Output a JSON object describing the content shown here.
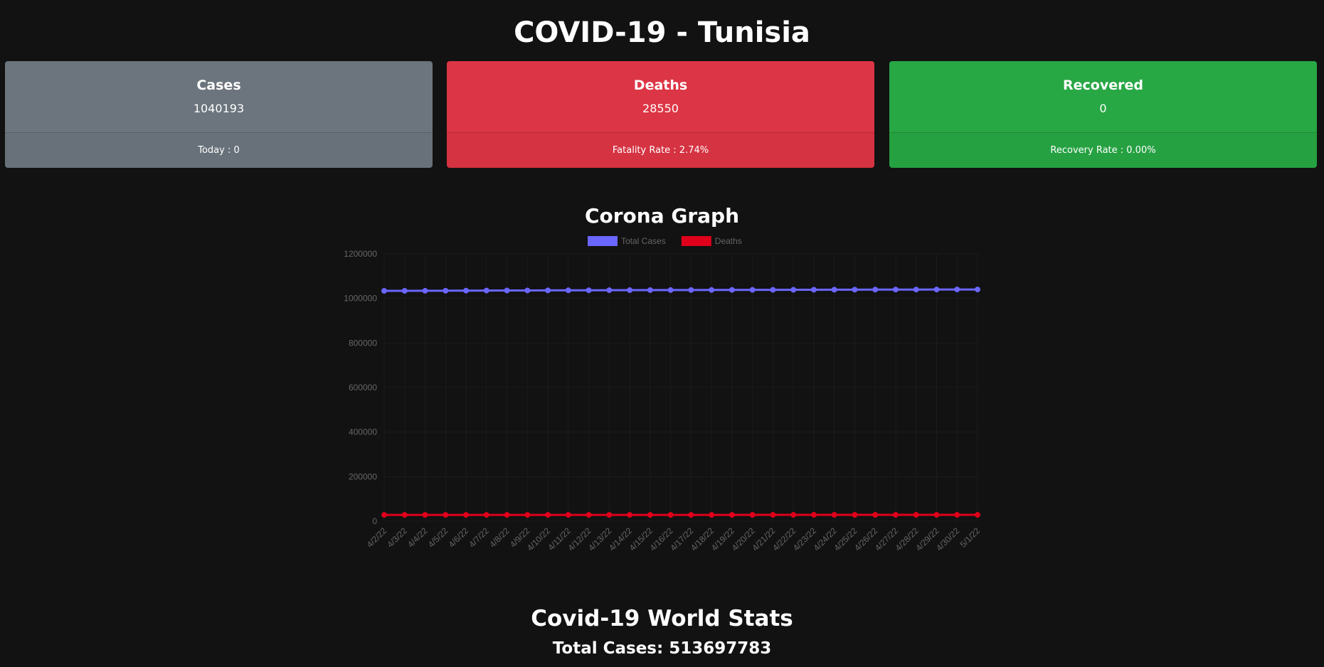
{
  "page": {
    "title": "COVID-19 - Tunisia"
  },
  "cards": {
    "cases": {
      "title": "Cases",
      "value": "1040193",
      "footer": "Today : 0",
      "color": "#6c757d"
    },
    "deaths": {
      "title": "Deaths",
      "value": "28550",
      "footer": "Fatality Rate : 2.74%",
      "color": "#dc3545"
    },
    "recovered": {
      "title": "Recovered",
      "value": "0",
      "footer": "Recovery Rate : 0.00%",
      "color": "#28a745"
    }
  },
  "graph": {
    "title": "Corona Graph"
  },
  "chart_data": {
    "type": "line",
    "title": "",
    "xlabel": "",
    "ylabel": "",
    "x": [
      "4/2/22",
      "4/3/22",
      "4/4/22",
      "4/5/22",
      "4/6/22",
      "4/7/22",
      "4/8/22",
      "4/9/22",
      "4/10/22",
      "4/11/22",
      "4/12/22",
      "4/13/22",
      "4/14/22",
      "4/15/22",
      "4/16/22",
      "4/17/22",
      "4/18/22",
      "4/19/22",
      "4/20/22",
      "4/21/22",
      "4/22/22",
      "4/23/22",
      "4/24/22",
      "4/25/22",
      "4/26/22",
      "4/27/22",
      "4/28/22",
      "4/29/22",
      "4/30/22",
      "5/1/22"
    ],
    "ylim": [
      0,
      1200000
    ],
    "yticks": [
      "0",
      "200000",
      "400000",
      "600000",
      "800000",
      "1000000",
      "1200000"
    ],
    "legend_position": "top",
    "grid": true,
    "series": [
      {
        "name": "Total Cases",
        "color": "#6b66ff",
        "values": [
          1034000,
          1034000,
          1034300,
          1034600,
          1035000,
          1035300,
          1035600,
          1035800,
          1036000,
          1036300,
          1036600,
          1036900,
          1037100,
          1037300,
          1037500,
          1037700,
          1037900,
          1038100,
          1038300,
          1038500,
          1038700,
          1038900,
          1039100,
          1039300,
          1039500,
          1039700,
          1039800,
          1039900,
          1040100,
          1040193
        ]
      },
      {
        "name": "Deaths",
        "color": "#e0001b",
        "values": [
          28450,
          28455,
          28460,
          28465,
          28470,
          28475,
          28480,
          28485,
          28490,
          28495,
          28500,
          28503,
          28506,
          28509,
          28512,
          28515,
          28518,
          28521,
          28524,
          28527,
          28530,
          28533,
          28536,
          28539,
          28541,
          28543,
          28545,
          28547,
          28549,
          28550
        ]
      }
    ]
  },
  "world": {
    "title": "Covid-19 World Stats",
    "total_cases": "Total Cases: 513697783"
  }
}
